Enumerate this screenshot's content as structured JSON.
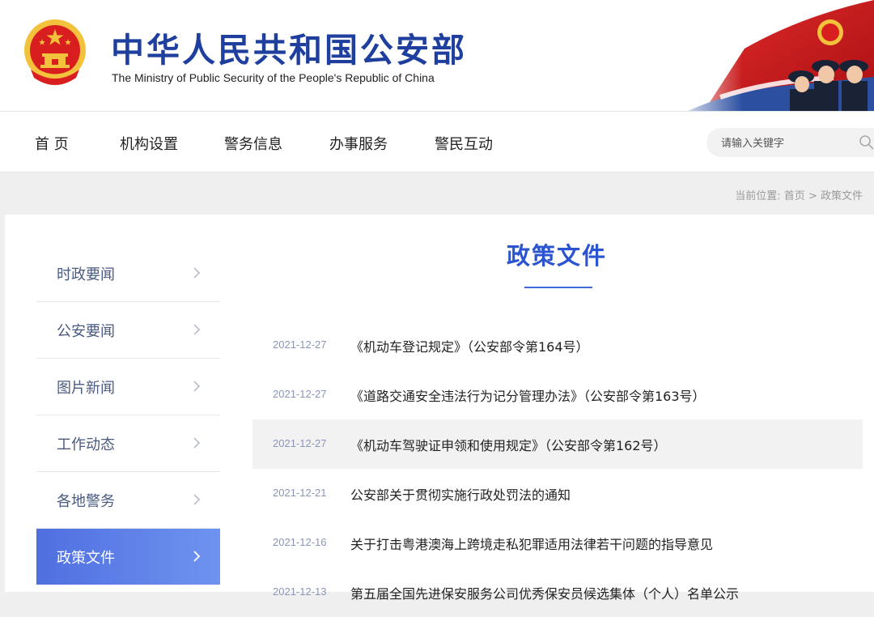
{
  "header": {
    "title_cn": "中华人民共和国公安部",
    "title_en": "The Ministry of Public Security of the People's Republic of China",
    "emblem_icon": "national-emblem-icon",
    "banner": "flag-police-banner"
  },
  "colors": {
    "brand_blue": "#1e3f9e",
    "accent_blue": "#2a54d1",
    "active_gradient_start": "#4f6fe0",
    "active_gradient_end": "#6f93f0",
    "emblem_red": "#d81e1e",
    "emblem_gold": "#f3c23c"
  },
  "nav": {
    "items": [
      "首  页",
      "机构设置",
      "警务信息",
      "办事服务",
      "警民互动"
    ],
    "search_placeholder": "请输入关键字",
    "search_icon": "search-icon"
  },
  "breadcrumb": {
    "prefix": "当前位置: ",
    "home": "首页",
    "separator": " > ",
    "current": "政策文件"
  },
  "sidebar": {
    "items": [
      {
        "label": "时政要闻"
      },
      {
        "label": "公安要闻"
      },
      {
        "label": "图片新闻"
      },
      {
        "label": "工作动态"
      },
      {
        "label": "各地警务"
      },
      {
        "label": "政策文件",
        "active": true
      }
    ],
    "chevron_icon": "chevron-right-icon"
  },
  "main": {
    "title": "政策文件",
    "list": [
      {
        "date": "2021-12-27",
        "title": "《机动车登记规定》（公安部令第164号）"
      },
      {
        "date": "2021-12-27",
        "title": "《道路交通安全违法行为记分管理办法》（公安部令第163号）"
      },
      {
        "date": "2021-12-27",
        "title": "《机动车驾驶证申领和使用规定》（公安部令第162号）",
        "highlighted": true
      },
      {
        "date": "2021-12-21",
        "title": "公安部关于贯彻实施行政处罚法的通知"
      },
      {
        "date": "2021-12-16",
        "title": "关于打击粤港澳海上跨境走私犯罪适用法律若干问题的指导意见"
      },
      {
        "date": "2021-12-13",
        "title": "第五届全国先进保安服务公司优秀保安员候选集体（个人）名单公示"
      }
    ]
  }
}
